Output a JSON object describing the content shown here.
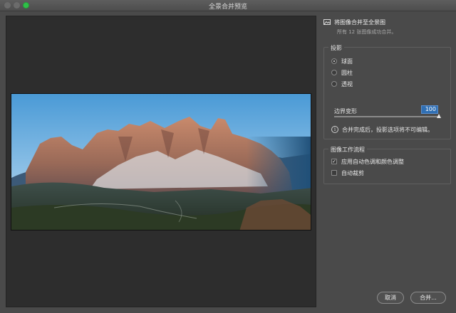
{
  "window": {
    "title": "全景合并预览"
  },
  "merge_header": {
    "title": "将图像合并至全景图",
    "subtitle": "所有 12 张图像成功合并。",
    "icon": "panorama-merge-icon"
  },
  "projection": {
    "label": "投影",
    "options": [
      {
        "label": "球面",
        "selected": true
      },
      {
        "label": "圆柱",
        "selected": false
      },
      {
        "label": "透视",
        "selected": false
      }
    ],
    "boundary_warp": {
      "label": "边界变形",
      "value": "100",
      "fraction": 1.0
    },
    "info_text": "合并完成后，投影选项将不可编辑。",
    "info_icon": "info-icon"
  },
  "workflow": {
    "label": "图像工作流程",
    "options": [
      {
        "label": "应用自动色调和颜色调整",
        "checked": true
      },
      {
        "label": "自动裁剪",
        "checked": false
      }
    ]
  },
  "buttons": {
    "cancel": "取消",
    "merge": "合并..."
  },
  "colors": {
    "accent": "#2f6fb4",
    "window_bg": "#4a4a4a",
    "preview_bg": "#2d2d2d",
    "close_button": "#2fc048"
  }
}
